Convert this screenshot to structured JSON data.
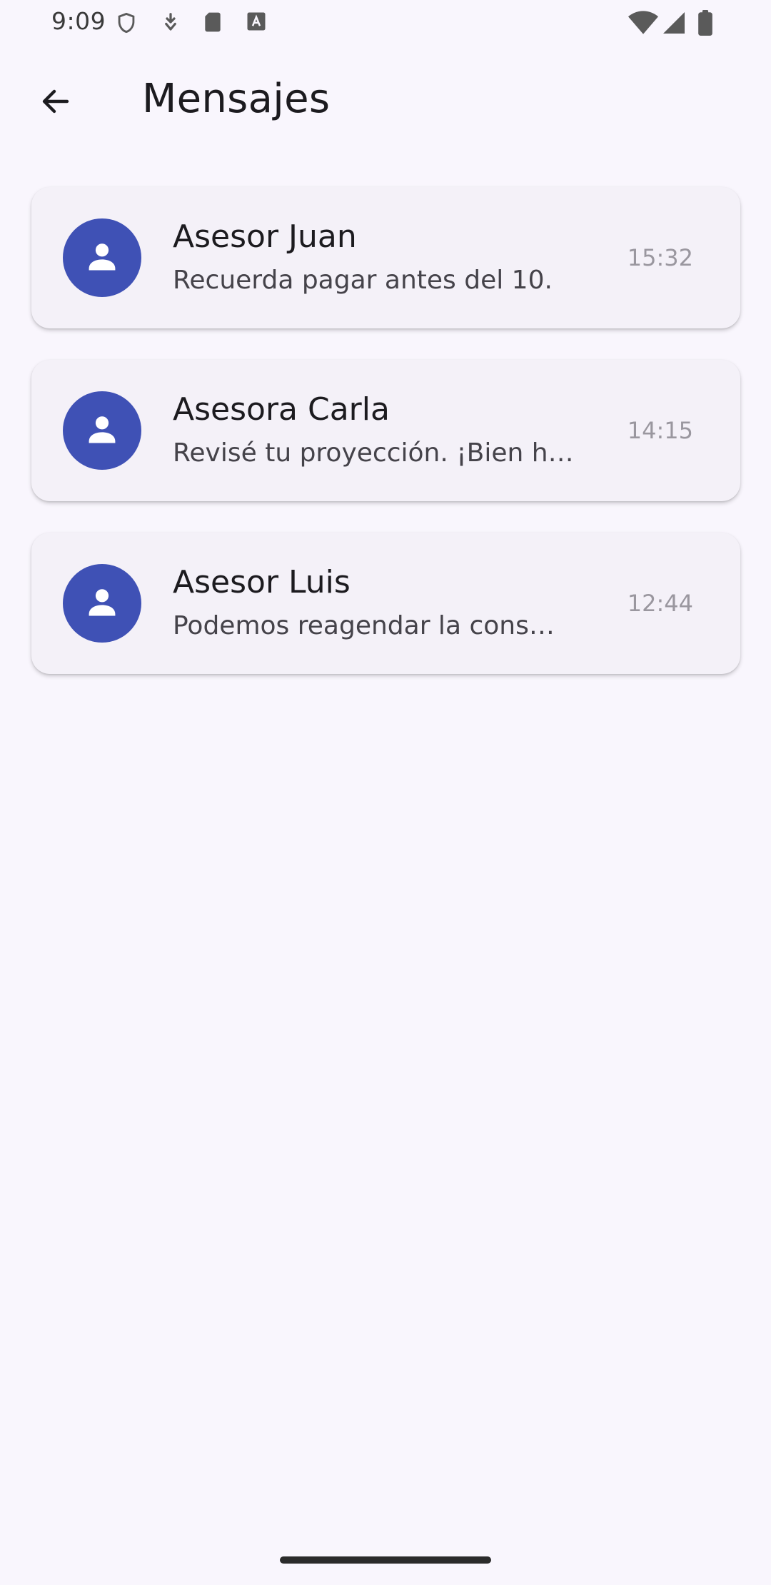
{
  "status_bar": {
    "time": "9:09",
    "icons": [
      "shield-icon",
      "download-icon",
      "sd-card-icon",
      "text-a-icon",
      "wifi-icon",
      "cellular-icon",
      "battery-icon"
    ]
  },
  "app_bar": {
    "title": "Mensajes",
    "back_icon": "arrow-back-icon"
  },
  "colors": {
    "background": "#f9f6fd",
    "card": "#f4f1f8",
    "avatar": "#3f51b5"
  },
  "messages": [
    {
      "name": "Asesor Juan",
      "preview": "Recuerda pagar antes del 10.",
      "time": "15:32",
      "icon": "person-icon"
    },
    {
      "name": "Asesora Carla",
      "preview": "Revisé tu proyección. ¡Bien h…",
      "time": "14:15",
      "icon": "person-icon"
    },
    {
      "name": "Asesor Luis",
      "preview": "Podemos reagendar la cons…",
      "time": "12:44",
      "icon": "person-icon"
    }
  ]
}
